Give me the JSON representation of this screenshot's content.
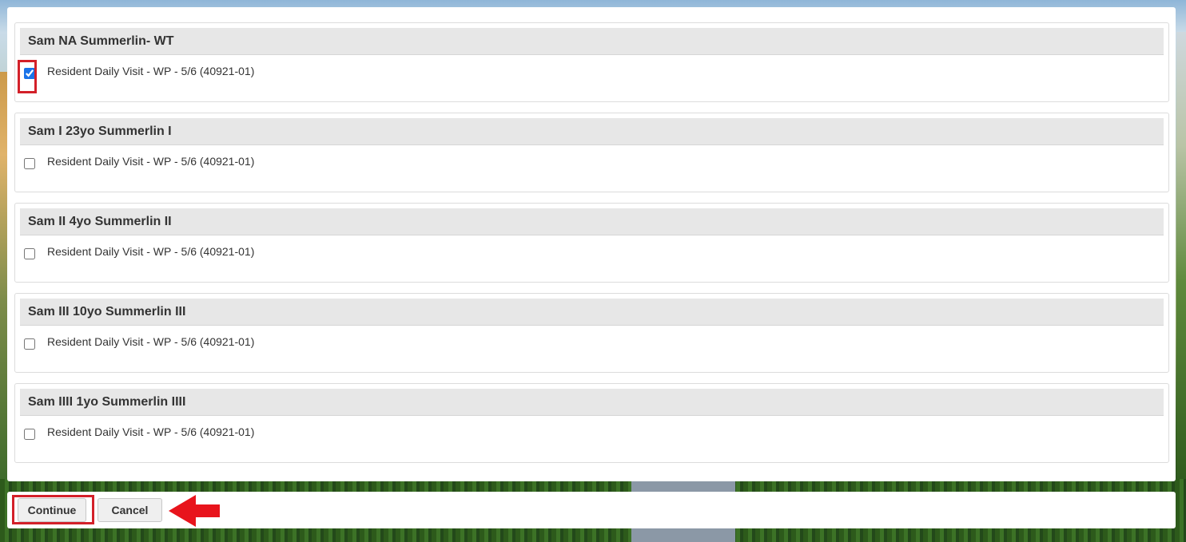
{
  "groups": [
    {
      "title": "Sam NA Summerlin- WT",
      "item_label": "Resident Daily Visit - WP - 5/6 (40921-01)",
      "checked": true
    },
    {
      "title": "Sam I 23yo Summerlin I",
      "item_label": "Resident Daily Visit - WP - 5/6 (40921-01)",
      "checked": false
    },
    {
      "title": "Sam II 4yo Summerlin II",
      "item_label": "Resident Daily Visit - WP - 5/6 (40921-01)",
      "checked": false
    },
    {
      "title": "Sam III 10yo Summerlin III",
      "item_label": "Resident Daily Visit - WP - 5/6 (40921-01)",
      "checked": false
    },
    {
      "title": "Sam IIII 1yo Summerlin IIII",
      "item_label": "Resident Daily Visit - WP - 5/6 (40921-01)",
      "checked": false
    }
  ],
  "footer": {
    "continue_label": "Continue",
    "cancel_label": "Cancel"
  },
  "annotations": {
    "highlight_color": "#d32029",
    "arrow_icon": "left-arrow-icon"
  },
  "colors": {
    "checkbox_accent": "#1a73e8",
    "header_bg": "#e7e7e7"
  }
}
